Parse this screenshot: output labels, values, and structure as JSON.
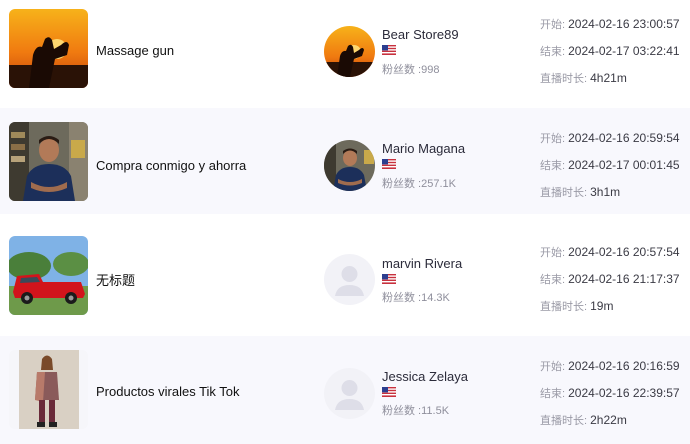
{
  "labels": {
    "start": "开始: ",
    "end": "结束: ",
    "duration": "直播时长: "
  },
  "streams": [
    {
      "title": "Massage gun",
      "thumb_icon": "sunset-heart-thumbnail",
      "host": "Bear Store89",
      "avatar_icon": "sunset-avatar",
      "flag_icon": "us-flag-icon",
      "fans": "粉丝数 :998",
      "start": "2024-02-16 23:00:57",
      "end": "2024-02-17 03:22:41",
      "duration": "4h21m"
    },
    {
      "title": "Compra conmigo y ahorra",
      "thumb_icon": "man-portrait-thumbnail",
      "host": "Mario Magana",
      "avatar_icon": "man-portrait-avatar",
      "flag_icon": "us-flag-icon",
      "fans": "粉丝数 :257.1K",
      "start": "2024-02-16 20:59:54",
      "end": "2024-02-17 00:01:45",
      "duration": "3h1m"
    },
    {
      "title": "无标题",
      "thumb_icon": "red-truck-thumbnail",
      "host": "marvin Rivera",
      "avatar_icon": "default-user-avatar",
      "flag_icon": "us-flag-icon",
      "fans": "粉丝数 :14.3K",
      "start": "2024-02-16 20:57:54",
      "end": "2024-02-16 21:17:37",
      "duration": "19m"
    },
    {
      "title": "Productos virales Tik Tok",
      "thumb_icon": "woman-portrait-thumbnail",
      "host": "Jessica Zelaya",
      "avatar_icon": "default-user-avatar",
      "flag_icon": "us-flag-icon",
      "fans": "粉丝数 :11.5K",
      "start": "2024-02-16 20:16:59",
      "end": "2024-02-16 22:39:57",
      "duration": "2h22m"
    }
  ]
}
